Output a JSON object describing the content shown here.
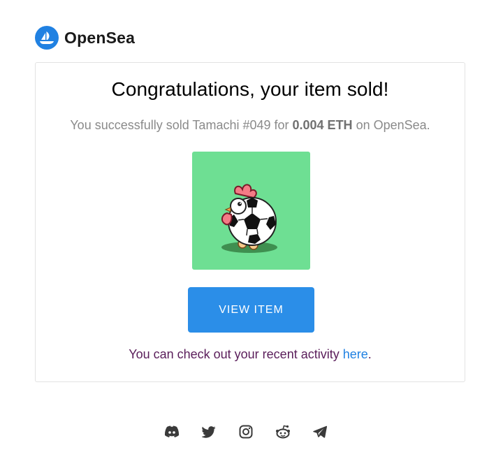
{
  "brand": {
    "name": "OpenSea",
    "color": "#2081e2"
  },
  "card": {
    "title": "Congratulations, your item sold!",
    "sub_prefix": "You successfully sold Tamachi #049 for ",
    "sub_price": "0.004 ETH",
    "sub_suffix": " on OpenSea.",
    "item_image_icon": "chicken-soccer-ball-icon",
    "item_bg": "#6edf93",
    "button_label": "VIEW ITEM",
    "button_color": "#2b8ee8",
    "activity_prefix": "You can check out your recent activity ",
    "activity_link": "here",
    "activity_suffix": "."
  },
  "footer": {
    "socials": [
      "discord-icon",
      "twitter-icon",
      "instagram-icon",
      "reddit-icon",
      "telegram-icon"
    ]
  }
}
